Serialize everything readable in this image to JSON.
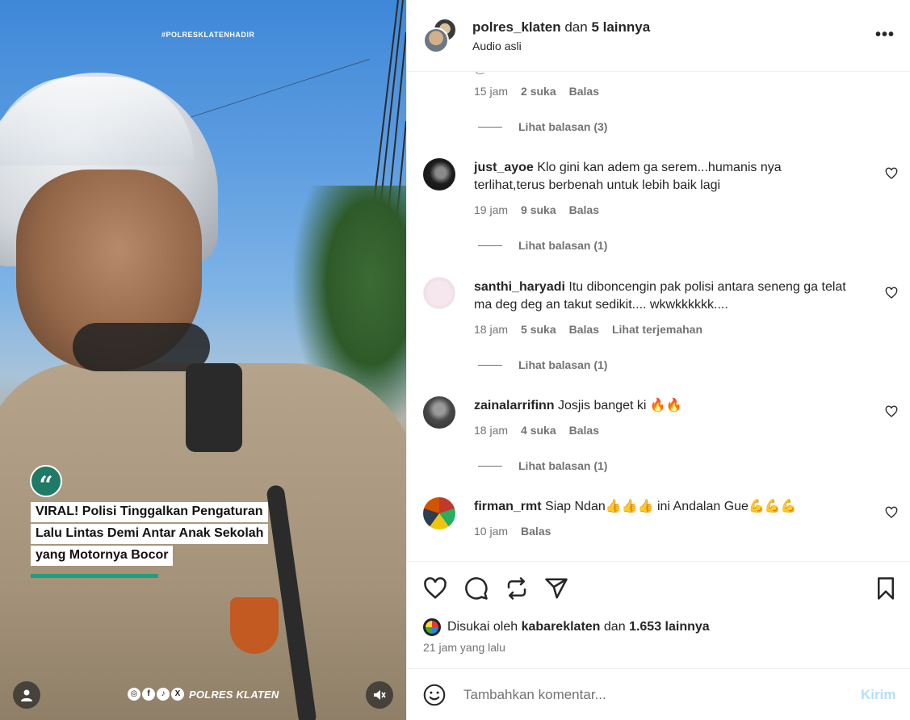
{
  "media": {
    "hashtag": "#POLRESKLATENHADIR",
    "quote_glyph": "“",
    "headline_lines": [
      "VIRAL! Polisi Tinggalkan Pengaturan",
      "Lalu Lintas Demi Antar Anak Sekolah",
      "yang Motornya Bocor"
    ],
    "brand_text": "POLRES KLATEN",
    "brand_icons": [
      "instagram-icon",
      "facebook-icon",
      "tiktok-icon",
      "x-icon"
    ],
    "accent_color": "#1f9e80"
  },
  "header": {
    "username": "polres_klaten",
    "and_text": "dan",
    "others": "5 lainnya",
    "audio": "Audio asli",
    "more_label": "•••"
  },
  "comments": [
    {
      "time": "15 jam",
      "likes": "2 suka",
      "reply": "Balas",
      "view_replies": "Lihat balasan (3)"
    },
    {
      "username": "just_ayoe",
      "text": "Klo gini kan adem ga serem...humanis nya terlihat,terus berbenah untuk lebih baik lagi",
      "time": "19 jam",
      "likes": "9 suka",
      "reply": "Balas",
      "view_replies": "Lihat balasan (1)"
    },
    {
      "username": "santhi_haryadi",
      "text": "Itu diboncengin pak polisi antara seneng ga telat ma deg deg an takut sedikit.... wkwkkkkkk....",
      "time": "18 jam",
      "likes": "5 suka",
      "reply": "Balas",
      "translate": "Lihat terjemahan",
      "view_replies": "Lihat balasan (1)"
    },
    {
      "username": "zainalarrifinn",
      "text": "Josjis banget ki 🔥🔥",
      "time": "18 jam",
      "likes": "4 suka",
      "reply": "Balas",
      "view_replies": "Lihat balasan (1)"
    },
    {
      "username": "firman_rmt",
      "text": "Siap Ndan👍👍👍 ini Andalan Gue💪💪💪",
      "time": "10 jam",
      "reply": "Balas"
    }
  ],
  "actions": {
    "liked_by_prefix": "Disukai oleh",
    "liked_by_user": "kabareklaten",
    "liked_by_and": "dan",
    "liked_by_count": "1.653 lainnya",
    "time_ago": "21 jam yang lalu"
  },
  "composer": {
    "placeholder": "Tambahkan komentar...",
    "send_label": "Kirim"
  },
  "colors": {
    "link_blue": "#00376b",
    "muted": "#737373",
    "send_disabled": "#b2dffc"
  }
}
